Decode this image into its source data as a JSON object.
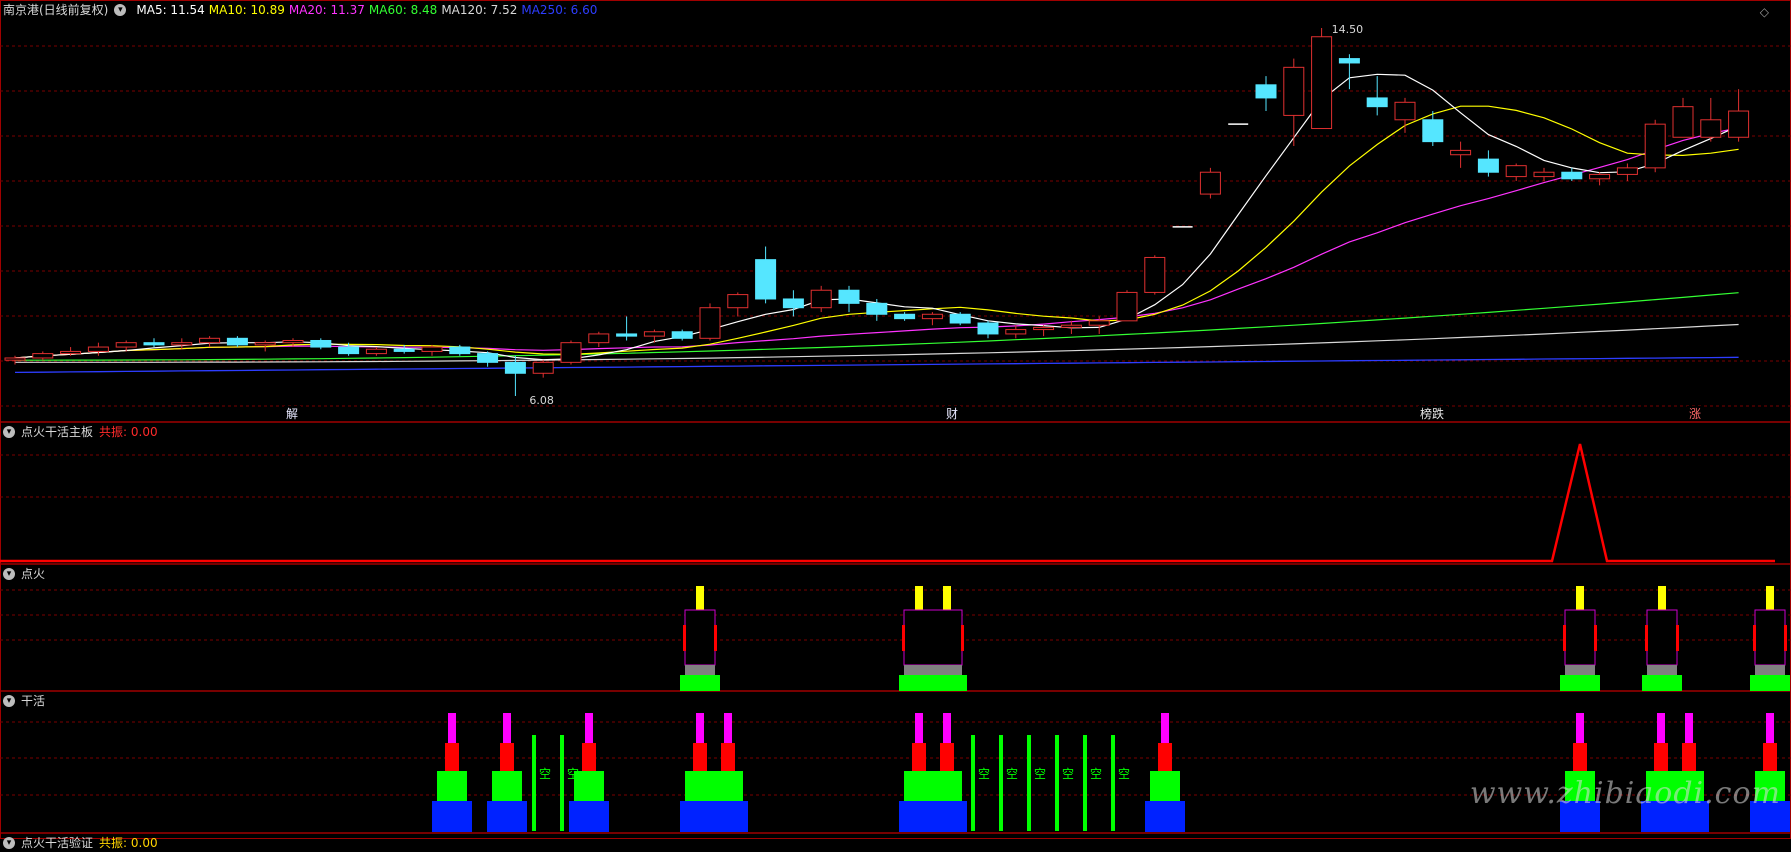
{
  "main_panel": {
    "title": "南京港(日线前复权)",
    "ma_values": [
      {
        "label": "MA5: 11.54",
        "color": "#ffffff"
      },
      {
        "label": "MA10: 10.89",
        "color": "#ffff00"
      },
      {
        "label": "MA20: 11.37",
        "color": "#ff33ff"
      },
      {
        "label": "MA60: 8.48",
        "color": "#33ff33"
      },
      {
        "label": "MA120: 7.52",
        "color": "#d8d8d8"
      },
      {
        "label": "MA250: 6.60",
        "color": "#2d3dff"
      }
    ],
    "high_label": "14.50",
    "low_label": "6.08",
    "event_tags": [
      "解",
      "财",
      "榜跌",
      "涨"
    ]
  },
  "panel_2": {
    "title": "点火干活主板",
    "value_label": "共振: 0.00"
  },
  "panel_3": {
    "title": "点火"
  },
  "panel_4": {
    "title": "干活",
    "bar_text": "空"
  },
  "panel_5": {
    "title": "点火干活验证",
    "value_label": "共振: 0.00"
  },
  "watermark": "www.zhibiaodi.com",
  "colors": {
    "background": "#000000",
    "grid": "#7a0000",
    "divider": "#a00000",
    "candle_up": "#e03030",
    "candle_down": "#55e6ff",
    "signal_line": "#ff0000",
    "yellow": "#ffff00",
    "magenta": "#ff00ff",
    "red": "#ff0000",
    "green": "#00ff00",
    "blue": "#0022ff",
    "gray": "#808080"
  },
  "chart_data": {
    "type": "candlestick",
    "high": 14.5,
    "low": 6.08,
    "candles": [
      [
        6.9,
        7.0,
        6.8,
        6.95
      ],
      [
        6.95,
        7.1,
        6.9,
        7.05
      ],
      [
        7.05,
        7.2,
        7.0,
        7.1
      ],
      [
        7.1,
        7.3,
        7.0,
        7.2
      ],
      [
        7.2,
        7.35,
        7.1,
        7.3
      ],
      [
        7.3,
        7.4,
        7.2,
        7.25
      ],
      [
        7.25,
        7.4,
        7.15,
        7.3
      ],
      [
        7.3,
        7.45,
        7.2,
        7.4
      ],
      [
        7.4,
        7.45,
        7.2,
        7.25
      ],
      [
        7.25,
        7.35,
        7.1,
        7.3
      ],
      [
        7.3,
        7.4,
        7.2,
        7.35
      ],
      [
        7.35,
        7.4,
        7.15,
        7.2
      ],
      [
        7.2,
        7.3,
        7.0,
        7.05
      ],
      [
        7.05,
        7.2,
        7.0,
        7.15
      ],
      [
        7.15,
        7.25,
        7.05,
        7.1
      ],
      [
        7.1,
        7.25,
        7.0,
        7.2
      ],
      [
        7.2,
        7.25,
        7.0,
        7.05
      ],
      [
        7.05,
        7.1,
        6.75,
        6.85
      ],
      [
        6.85,
        7.0,
        6.08,
        6.6
      ],
      [
        6.6,
        6.9,
        6.5,
        6.85
      ],
      [
        6.85,
        7.35,
        6.8,
        7.3
      ],
      [
        7.3,
        7.55,
        7.2,
        7.5
      ],
      [
        7.5,
        7.9,
        7.35,
        7.45
      ],
      [
        7.45,
        7.6,
        7.3,
        7.55
      ],
      [
        7.55,
        7.6,
        7.35,
        7.4
      ],
      [
        7.4,
        8.2,
        7.35,
        8.1
      ],
      [
        8.1,
        8.45,
        7.9,
        8.4
      ],
      [
        9.2,
        9.5,
        8.2,
        8.3
      ],
      [
        8.3,
        8.5,
        7.9,
        8.1
      ],
      [
        8.1,
        8.6,
        8.0,
        8.5
      ],
      [
        8.5,
        8.6,
        8.0,
        8.2
      ],
      [
        8.2,
        8.3,
        7.8,
        7.95
      ],
      [
        7.95,
        8.0,
        7.8,
        7.85
      ],
      [
        7.85,
        8.0,
        7.7,
        7.95
      ],
      [
        7.95,
        8.0,
        7.7,
        7.75
      ],
      [
        7.75,
        7.8,
        7.4,
        7.5
      ],
      [
        7.5,
        7.7,
        7.4,
        7.6
      ],
      [
        7.6,
        7.7,
        7.45,
        7.65
      ],
      [
        7.65,
        7.8,
        7.5,
        7.7
      ],
      [
        7.7,
        7.9,
        7.5,
        7.8
      ],
      [
        7.8,
        8.5,
        7.8,
        8.45
      ],
      [
        8.45,
        9.3,
        8.4,
        9.25
      ],
      [
        9.95,
        9.95,
        9.95,
        9.95
      ],
      [
        10.7,
        11.3,
        10.6,
        11.2
      ],
      [
        12.3,
        12.3,
        12.3,
        12.3
      ],
      [
        13.2,
        13.4,
        12.6,
        12.9
      ],
      [
        12.5,
        13.8,
        11.8,
        13.6
      ],
      [
        12.2,
        14.5,
        12.2,
        14.3
      ],
      [
        13.8,
        13.9,
        13.1,
        13.7
      ],
      [
        12.9,
        13.4,
        12.5,
        12.7
      ],
      [
        12.4,
        12.9,
        12.1,
        12.8
      ],
      [
        12.4,
        12.6,
        11.8,
        11.9
      ],
      [
        11.6,
        11.9,
        11.3,
        11.7
      ],
      [
        11.5,
        11.7,
        11.1,
        11.2
      ],
      [
        11.1,
        11.4,
        11.0,
        11.35
      ],
      [
        11.1,
        11.3,
        11.0,
        11.2
      ],
      [
        11.2,
        11.3,
        11.0,
        11.05
      ],
      [
        11.05,
        11.2,
        10.9,
        11.15
      ],
      [
        11.15,
        11.4,
        11.0,
        11.3
      ],
      [
        11.3,
        12.4,
        11.2,
        12.3
      ],
      [
        12.0,
        12.9,
        12.0,
        12.7
      ],
      [
        12.0,
        12.9,
        11.9,
        12.4
      ],
      [
        12.0,
        13.1,
        11.9,
        12.6
      ]
    ]
  }
}
